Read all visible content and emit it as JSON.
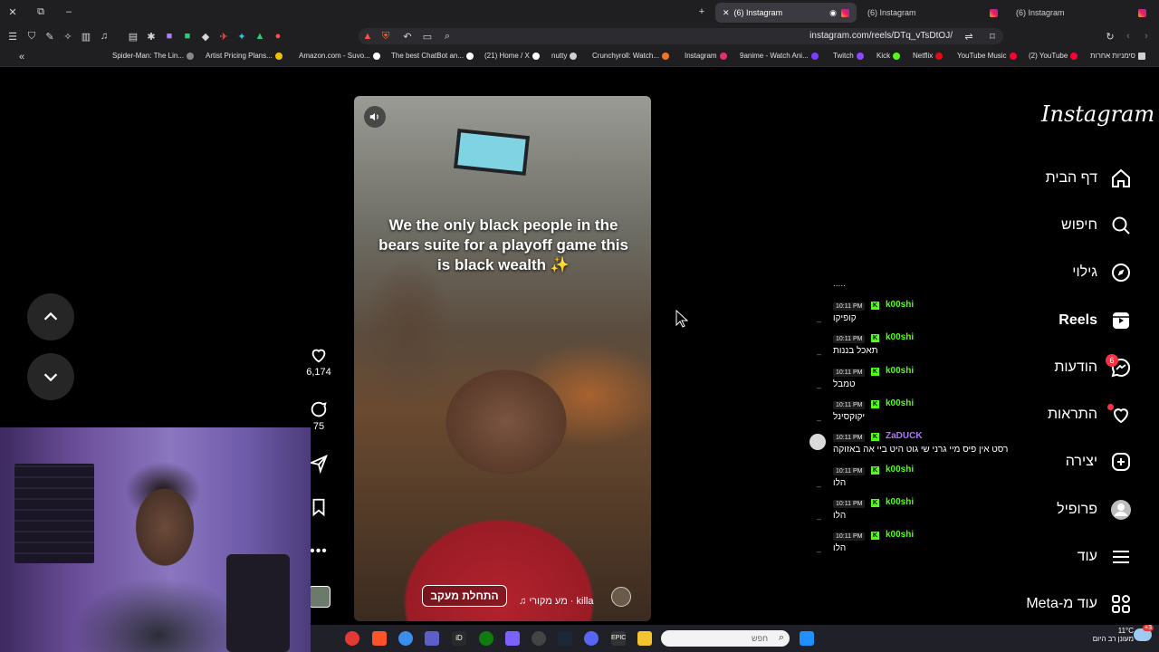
{
  "browser": {
    "tabs": [
      {
        "label": "(6) Instagram",
        "active": true
      },
      {
        "label": "(6) Instagram",
        "active": false
      },
      {
        "label": "(6) Instagram",
        "active": false
      }
    ],
    "url": "instagram.com/reels/DTq_vTsDtOJ/",
    "bookmarks": [
      {
        "label": "Spider-Man: The Lin...",
        "color": "#888888"
      },
      {
        "label": "Artist Pricing Plans...",
        "color": "#f2c200"
      },
      {
        "label": "Amazon.com - Suvo...",
        "color": "#ffffff"
      },
      {
        "label": "The best ChatBot an...",
        "color": "#ffffff"
      },
      {
        "label": "(21) Home / X",
        "color": "#ffffff"
      },
      {
        "label": "nutty",
        "color": "#cfcfcf"
      },
      {
        "label": "Crunchyroll: Watch...",
        "color": "#f47521"
      },
      {
        "label": "Instagram",
        "color": "#e1306c"
      },
      {
        "label": "9anime - Watch Ani...",
        "color": "#7a3cff"
      },
      {
        "label": "Twitch",
        "color": "#9146ff"
      },
      {
        "label": "Kick",
        "color": "#53fc18"
      },
      {
        "label": "Netflix",
        "color": "#e50914"
      },
      {
        "label": "YouTube Music",
        "color": "#ff0033"
      },
      {
        "label": "(2) YouTube",
        "color": "#ff0033"
      },
      {
        "label": "סימניות אחרות",
        "color": "#cfcfcf"
      }
    ]
  },
  "reel": {
    "caption": "We the only black people in the bears suite for a playoff game this is black wealth ✨",
    "follow_label": "התחלת מעקב",
    "audio_label": "♫ מע מקורי · killa",
    "likes": "6,174",
    "comments": "75"
  },
  "nav": {
    "logo": "Instagram",
    "items": [
      {
        "label": "דף הבית",
        "icon": "home-icon"
      },
      {
        "label": "חיפוש",
        "icon": "search-icon"
      },
      {
        "label": "גילוי",
        "icon": "compass-icon"
      },
      {
        "label": "Reels",
        "icon": "reels-icon"
      },
      {
        "label": "הודעות",
        "icon": "messenger-icon",
        "badge": "6"
      },
      {
        "label": "התראות",
        "icon": "heart-icon"
      },
      {
        "label": "יצירה",
        "icon": "plus-square-icon"
      },
      {
        "label": "פרופיל",
        "icon": "avatar-icon"
      },
      {
        "label": "עוד",
        "icon": "menu-icon"
      },
      {
        "label": "עוד מ-Meta",
        "icon": "grid-icon"
      }
    ]
  },
  "chat": {
    "overflow": ".....",
    "messages": [
      {
        "time": "10:11 PM",
        "user": "k00shi",
        "text": "קופיקו",
        "user_color": "#53fc18"
      },
      {
        "time": "10:11 PM",
        "user": "k00shi",
        "text": "תאכל בננות",
        "user_color": "#53fc18"
      },
      {
        "time": "10:11 PM",
        "user": "k00shi",
        "text": "טמבל",
        "user_color": "#53fc18"
      },
      {
        "time": "10:11 PM",
        "user": "k00shi",
        "text": "יקוקסינל",
        "user_color": "#53fc18"
      },
      {
        "time": "10:11 PM",
        "user": "ZaDUCK",
        "text": "רסט אין פיס מיי גרני שי גוט היט ביי אה באזוקה",
        "user_color": "#b072ff"
      },
      {
        "time": "10:11 PM",
        "user": "k00shi",
        "text": "הלו",
        "user_color": "#53fc18"
      },
      {
        "time": "10:11 PM",
        "user": "k00shi",
        "text": "הלו",
        "user_color": "#53fc18"
      },
      {
        "time": "10:11 PM",
        "user": "k00shi",
        "text": "הלו",
        "user_color": "#53fc18"
      }
    ]
  },
  "taskbar": {
    "search_placeholder": "חפש",
    "weather_temp": "11°C",
    "weather_desc": "מעונן רב היום",
    "notif_count": "+3"
  }
}
